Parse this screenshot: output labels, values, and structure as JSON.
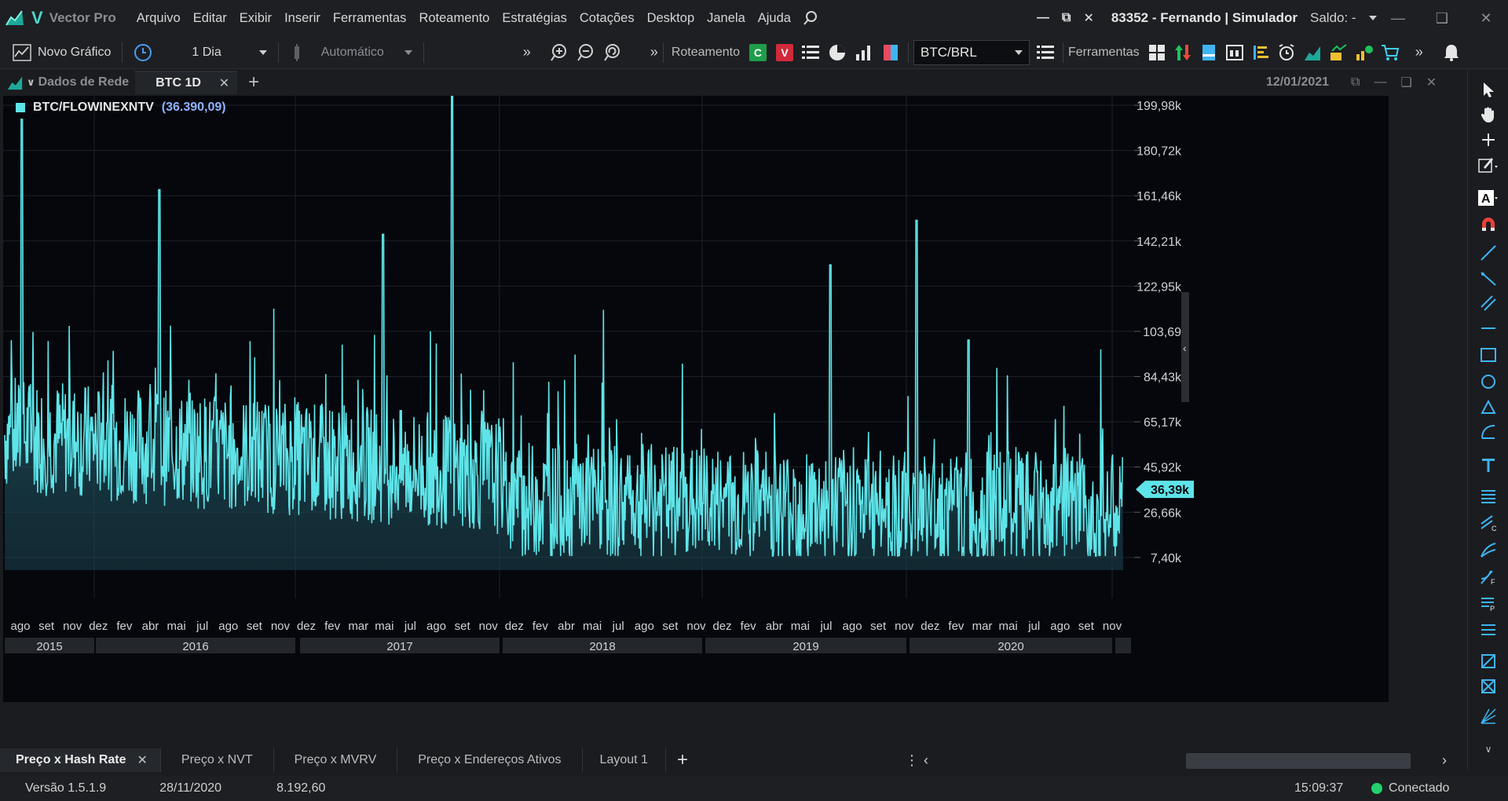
{
  "app": {
    "brand_letter": "V",
    "title": "Vector Pro"
  },
  "menu": [
    "Arquivo",
    "Editar",
    "Exibir",
    "Inserir",
    "Ferramentas",
    "Roteamento",
    "Estratégias",
    "Cotações",
    "Desktop",
    "Janela",
    "Ajuda"
  ],
  "account": {
    "label": "83352 - Fernando | Simulador",
    "saldo": "Saldo: -"
  },
  "toolbar": {
    "new_chart": "Novo Gráfico",
    "interval": "1 Dia",
    "mode": "Automático",
    "routing_label": "Roteamento",
    "buy_badge": "C",
    "sell_badge": "V",
    "symbol": "BTC/BRL",
    "tools_label": "Ferramentas"
  },
  "tabs": {
    "sub_label": "Dados de Rede",
    "active_tab": "BTC 1D",
    "date": "12/01/2021"
  },
  "chart_legend": {
    "name": "BTC/FLOWINEXNTV",
    "value": "(36.390,09)"
  },
  "chart_data": {
    "type": "area",
    "series": [
      {
        "name": "BTC/FLOWINEXNTV"
      }
    ],
    "y_axis": {
      "ticks": [
        199.98,
        180.72,
        161.46,
        142.21,
        122.95,
        103.69,
        84.43,
        65.17,
        45.92,
        26.66,
        7.4
      ],
      "tick_labels": [
        "199,98k",
        "180,72k",
        "161,46k",
        "142,21k",
        "122,95k",
        "103,69",
        "84,43k",
        "65,17k",
        "45,92k",
        "26,66k",
        "7,40k"
      ],
      "unit": "k",
      "range": [
        2,
        204
      ]
    },
    "current_value_label": "36,39k",
    "current_value": 36.39,
    "x_axis": {
      "months": [
        "ago",
        "set",
        "nov",
        "dez",
        "fev",
        "abr",
        "mai",
        "jul",
        "ago",
        "set",
        "nov",
        "dez",
        "fev",
        "mar",
        "mai",
        "jul",
        "ago",
        "set",
        "nov",
        "dez",
        "fev",
        "abr",
        "mai",
        "jul",
        "ago",
        "set",
        "nov",
        "dez",
        "fev",
        "abr",
        "mai",
        "jul",
        "ago",
        "set",
        "nov",
        "dez",
        "fev",
        "mar",
        "mai",
        "jul",
        "ago",
        "set",
        "nov"
      ],
      "years": [
        "2015",
        "2016",
        "2017",
        "2018",
        "2019",
        "2020"
      ]
    },
    "approx_peaks": [
      {
        "date": "2015-09",
        "value": 194
      },
      {
        "date": "2016-05",
        "value": 164
      },
      {
        "date": "2017-06",
        "value": 145
      },
      {
        "date": "2017-10",
        "value": 204
      },
      {
        "date": "2019-08",
        "value": 132
      },
      {
        "date": "2020-01",
        "value": 151
      },
      {
        "date": "2020-04",
        "value": 100
      }
    ],
    "grid": true,
    "color": "#5ee4e8"
  },
  "layouts": {
    "tabs": [
      "Preço x Hash Rate",
      "Preço x NVT",
      "Preço x MVRV",
      "Preço x Endereços Ativos",
      "Layout 1"
    ]
  },
  "status": {
    "version": "Versão 1.5.1.9",
    "date": "28/11/2020",
    "value": "8.192,60",
    "time": "15:09:37",
    "connection": "Conectado"
  }
}
